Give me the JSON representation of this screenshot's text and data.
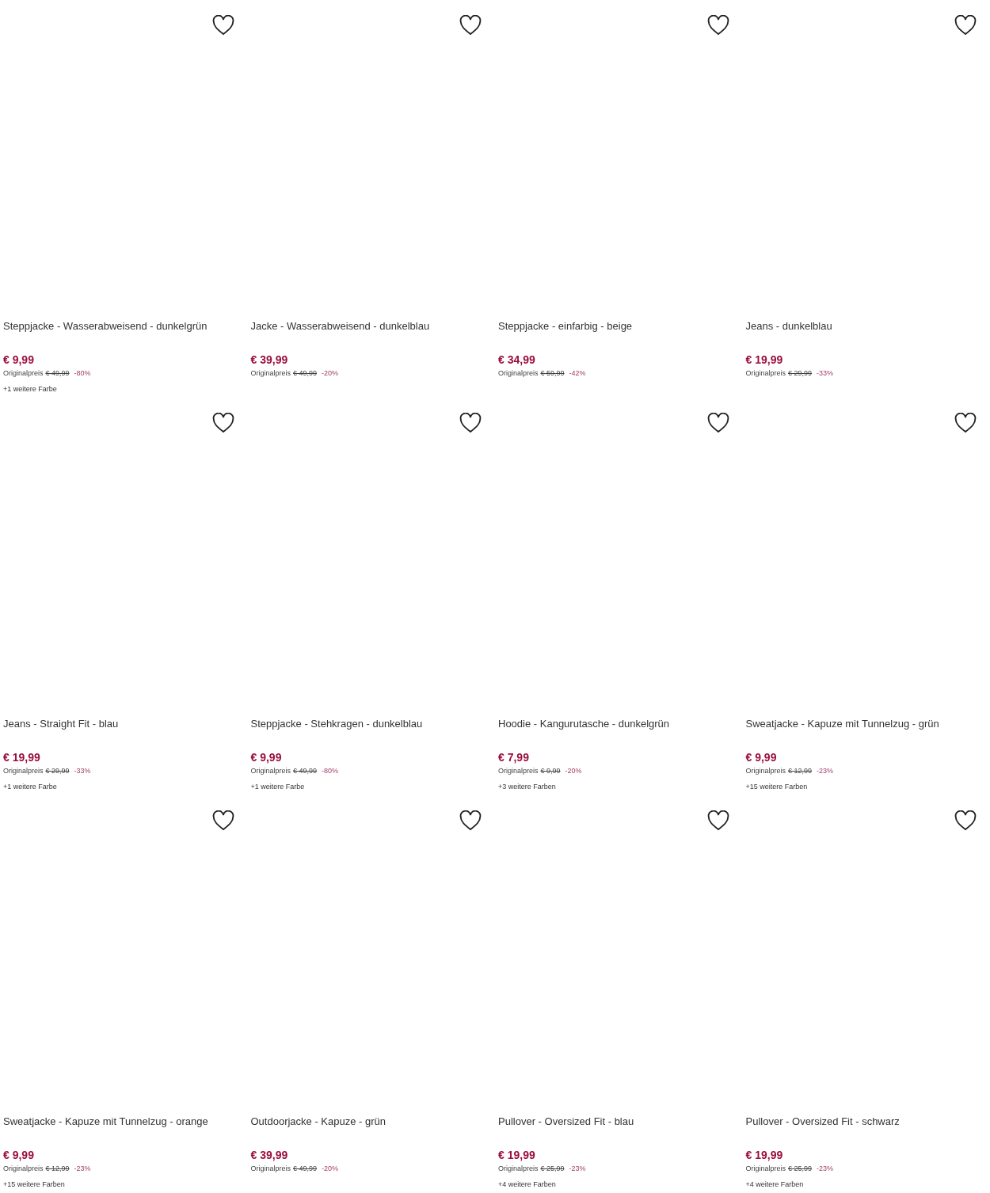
{
  "products": [
    {
      "title": "Steppjacke - Wasserabweisend - dunkelgrün",
      "price": "€ 9,99",
      "original_label": "Originalpreis",
      "original_price": "€ 49,99",
      "discount": "-80%",
      "more_colors": "+1 weitere Farbe",
      "favorite": false
    },
    {
      "title": "Jacke - Wasserabweisend - dunkelblau",
      "price": "€ 39,99",
      "original_label": "Originalpreis",
      "original_price": "€ 49,99",
      "discount": "-20%",
      "favorite": false
    },
    {
      "title": "Steppjacke - einfarbig - beige",
      "price": "€ 34,99",
      "original_label": "Originalpreis",
      "original_price": "€ 59,99",
      "discount": "-42%",
      "favorite": false
    },
    {
      "title": "Jeans - dunkelblau",
      "price": "€ 19,99",
      "original_label": "Originalpreis",
      "original_price": "€ 29,99",
      "discount": "-33%",
      "favorite": false
    },
    {
      "title": "Jeans - Straight Fit - blau",
      "price": "€ 19,99",
      "original_label": "Originalpreis",
      "original_price": "€ 29,99",
      "discount": "-33%",
      "more_colors": "+1 weitere Farbe",
      "favorite": false
    },
    {
      "title": "Steppjacke - Stehkragen - dunkelblau",
      "price": "€ 9,99",
      "original_label": "Originalpreis",
      "original_price": "€ 49,99",
      "discount": "-80%",
      "more_colors": "+1 weitere Farbe",
      "favorite": false
    },
    {
      "title": "Hoodie - Kangurutasche - dunkelgrün",
      "price": "€ 7,99",
      "original_label": "Originalpreis",
      "original_price": "€ 9,99",
      "discount": "-20%",
      "more_colors": "+3 weitere Farben",
      "favorite": false
    },
    {
      "title": "Sweatjacke - Kapuze mit Tunnelzug - grün",
      "price": "€ 9,99",
      "original_label": "Originalpreis",
      "original_price": "€ 12,99",
      "discount": "-23%",
      "more_colors": "+15 weitere Farben",
      "favorite": false
    },
    {
      "title": "Sweatjacke - Kapuze mit Tunnelzug - orange",
      "price": "€ 9,99",
      "original_label": "Originalpreis",
      "original_price": "€ 12,99",
      "discount": "-23%",
      "more_colors": "+15 weitere Farben",
      "favorite": false
    },
    {
      "title": "Outdoorjacke - Kapuze - grün",
      "price": "€ 39,99",
      "original_label": "Originalpreis",
      "original_price": "€ 49,99",
      "discount": "-20%",
      "favorite": false
    },
    {
      "title": "Pullover - Oversized Fit - blau",
      "price": "€ 19,99",
      "original_label": "Originalpreis",
      "original_price": "€ 25,99",
      "discount": "-23%",
      "more_colors": "+4 weitere Farben",
      "favorite": false
    },
    {
      "title": "Pullover - Oversized Fit - schwarz",
      "price": "€ 19,99",
      "original_label": "Originalpreis",
      "original_price": "€ 25,99",
      "discount": "-23%",
      "more_colors": "+4 weitere Farben",
      "favorite": false
    }
  ]
}
